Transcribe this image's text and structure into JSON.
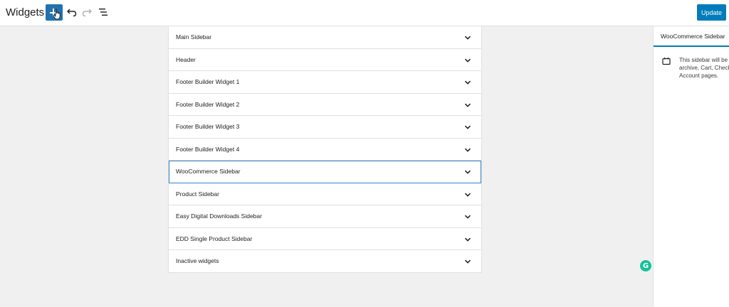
{
  "header": {
    "title": "Widgets",
    "update_label": "Update"
  },
  "icons": {
    "add": "plus-icon",
    "undo": "undo-icon",
    "redo": "redo-icon",
    "list_view": "list-view-icon",
    "chevron": "chevron-down-icon",
    "widget_area": "widget-area-icon",
    "grammarly": "grammarly-icon"
  },
  "colors": {
    "accent": "#007cba",
    "add_button": "#2271b1",
    "grammarly": "#15c39a"
  },
  "areas": [
    {
      "label": "Main Sidebar"
    },
    {
      "label": "Header"
    },
    {
      "label": "Footer Builder Widget 1"
    },
    {
      "label": "Footer Builder Widget 2"
    },
    {
      "label": "Footer Builder Widget 3"
    },
    {
      "label": "Footer Builder Widget 4"
    },
    {
      "label": "WooCommerce Sidebar"
    },
    {
      "label": "Product Sidebar"
    },
    {
      "label": "Easy Digital Downloads Sidebar"
    },
    {
      "label": "EDD Single Product Sidebar"
    },
    {
      "label": "Inactive widgets"
    }
  ],
  "inspector": {
    "tab_label": "WooCommerce Sidebar",
    "desc_lines": [
      "This sidebar will be",
      "archive, Cart, Checko",
      "Account pages."
    ]
  }
}
